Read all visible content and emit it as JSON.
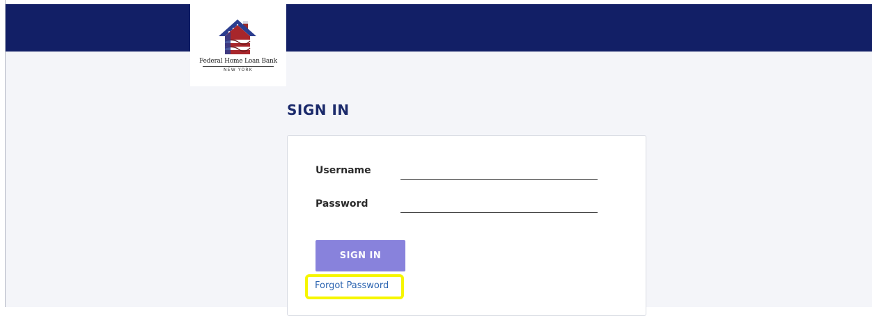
{
  "header": {
    "background_color": "#121f66"
  },
  "logo": {
    "name": "Federal Home Loan Bank",
    "subtitle": "NEW YORK",
    "icon": "flag-house-icon"
  },
  "page": {
    "title": "SIGN IN"
  },
  "form": {
    "username_label": "Username",
    "username_value": "",
    "password_label": "Password",
    "password_value": "",
    "submit_label": "SIGN IN",
    "submit_color": "#8882dc",
    "forgot_password_label": "Forgot Password",
    "forgot_password_highlight_color": "#f6f600"
  }
}
